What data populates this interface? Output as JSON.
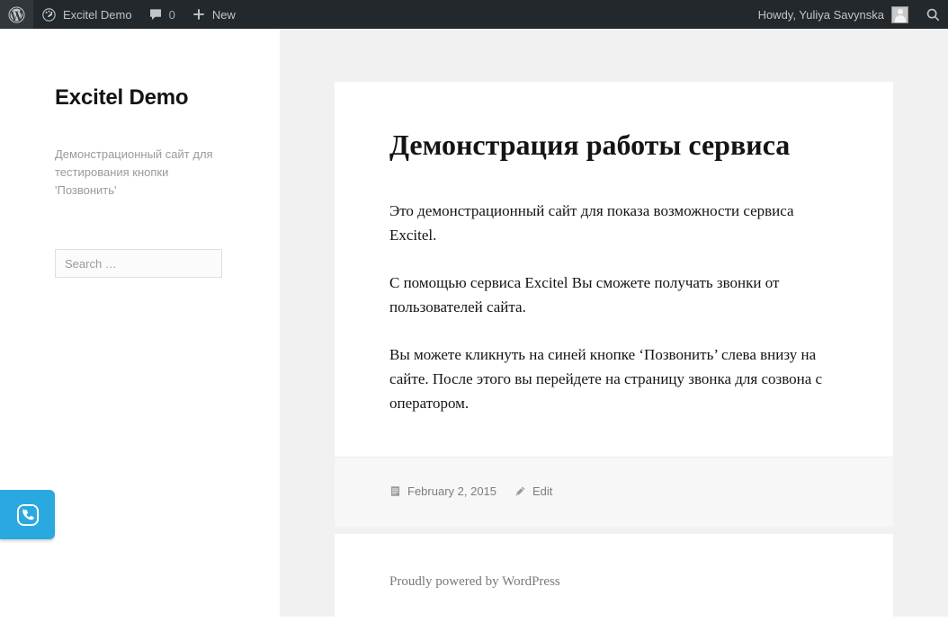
{
  "adminbar": {
    "wp_logo_icon": "wordpress-logo-icon",
    "site_icon": "dashboard-speedometer-icon",
    "site_name": "Excitel Demo",
    "comments_icon": "comment-bubble-icon",
    "comments_count": "0",
    "new_icon": "plus-icon",
    "new_label": "New",
    "howdy": "Howdy, Yuliya Savynska",
    "avatar": "user-avatar",
    "search_icon": "search-icon"
  },
  "sidebar": {
    "title": "Excitel Demo",
    "description": "Демонстрационный сайт для тестирования кнопки 'Позвонить'",
    "search": {
      "placeholder": "Search …",
      "value": ""
    }
  },
  "article": {
    "title": "Демонстрация работы сервиса",
    "paragraphs": [
      "Это демонстрационный сайт для показа возможности сервиса Excitel.",
      "С помощью сервиса Excitel Вы сможете получать звонки от пользователей сайта.",
      "Вы можете кликнуть на синей кнопке ‘Позвонить’ слева внизу на сайте. После этого вы перейдете на страницу звонка для созвона с оператором."
    ],
    "footer": {
      "date_icon": "calendar-icon",
      "date": "February 2, 2015",
      "edit_icon": "pencil-icon",
      "edit_label": "Edit"
    }
  },
  "footer": {
    "site_info": "Proudly powered by WordPress"
  },
  "call_widget": {
    "icon": "phone-call-icon",
    "color": "#29a9df"
  }
}
